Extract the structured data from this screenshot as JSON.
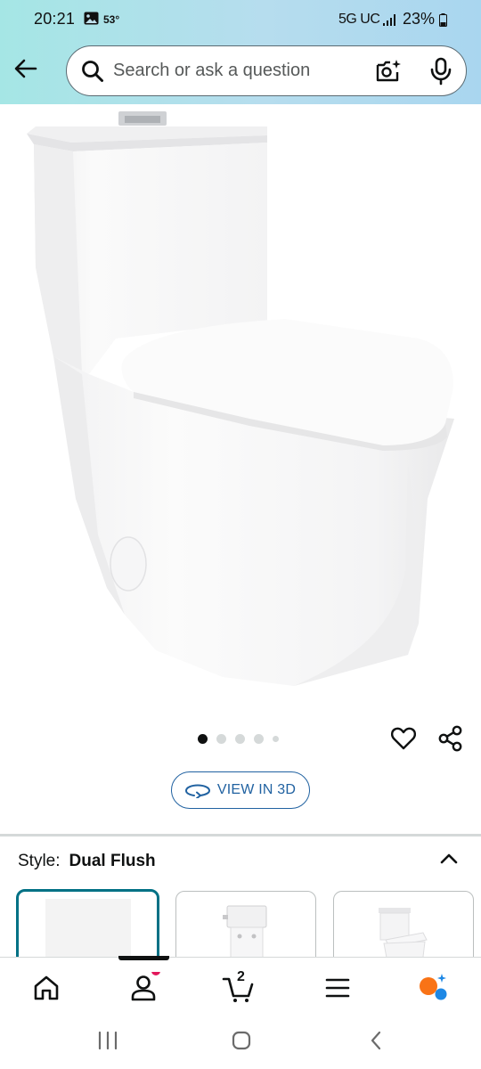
{
  "status_bar": {
    "time": "20:21",
    "temperature": "53°",
    "network": "5G UC",
    "battery": "23%"
  },
  "search": {
    "placeholder": "Search or ask a question"
  },
  "carousel": {
    "image_count": 5,
    "active_index": 0
  },
  "view_3d": {
    "label": "VIEW IN 3D"
  },
  "style": {
    "label": "Style:",
    "value": "Dual Flush",
    "selected_index": 0
  },
  "cart": {
    "count": "2"
  },
  "colors": {
    "accent_link": "#2162a1",
    "selected_border": "#007185",
    "notification_dot": "#e2185b",
    "rufus_orange": "#f97316",
    "rufus_blue": "#1e88e5"
  },
  "icons": {
    "back": "arrow-left-icon",
    "search": "search-icon",
    "camera": "camera-lens-icon",
    "mic": "microphone-icon",
    "wishlist": "heart-icon",
    "share": "share-icon",
    "view3d": "rotate-3d-icon",
    "collapse": "chevron-up-icon",
    "home": "home-icon",
    "account": "person-icon",
    "cart": "cart-icon",
    "menu": "hamburger-menu-icon",
    "rufus": "rufus-ai-icon"
  }
}
